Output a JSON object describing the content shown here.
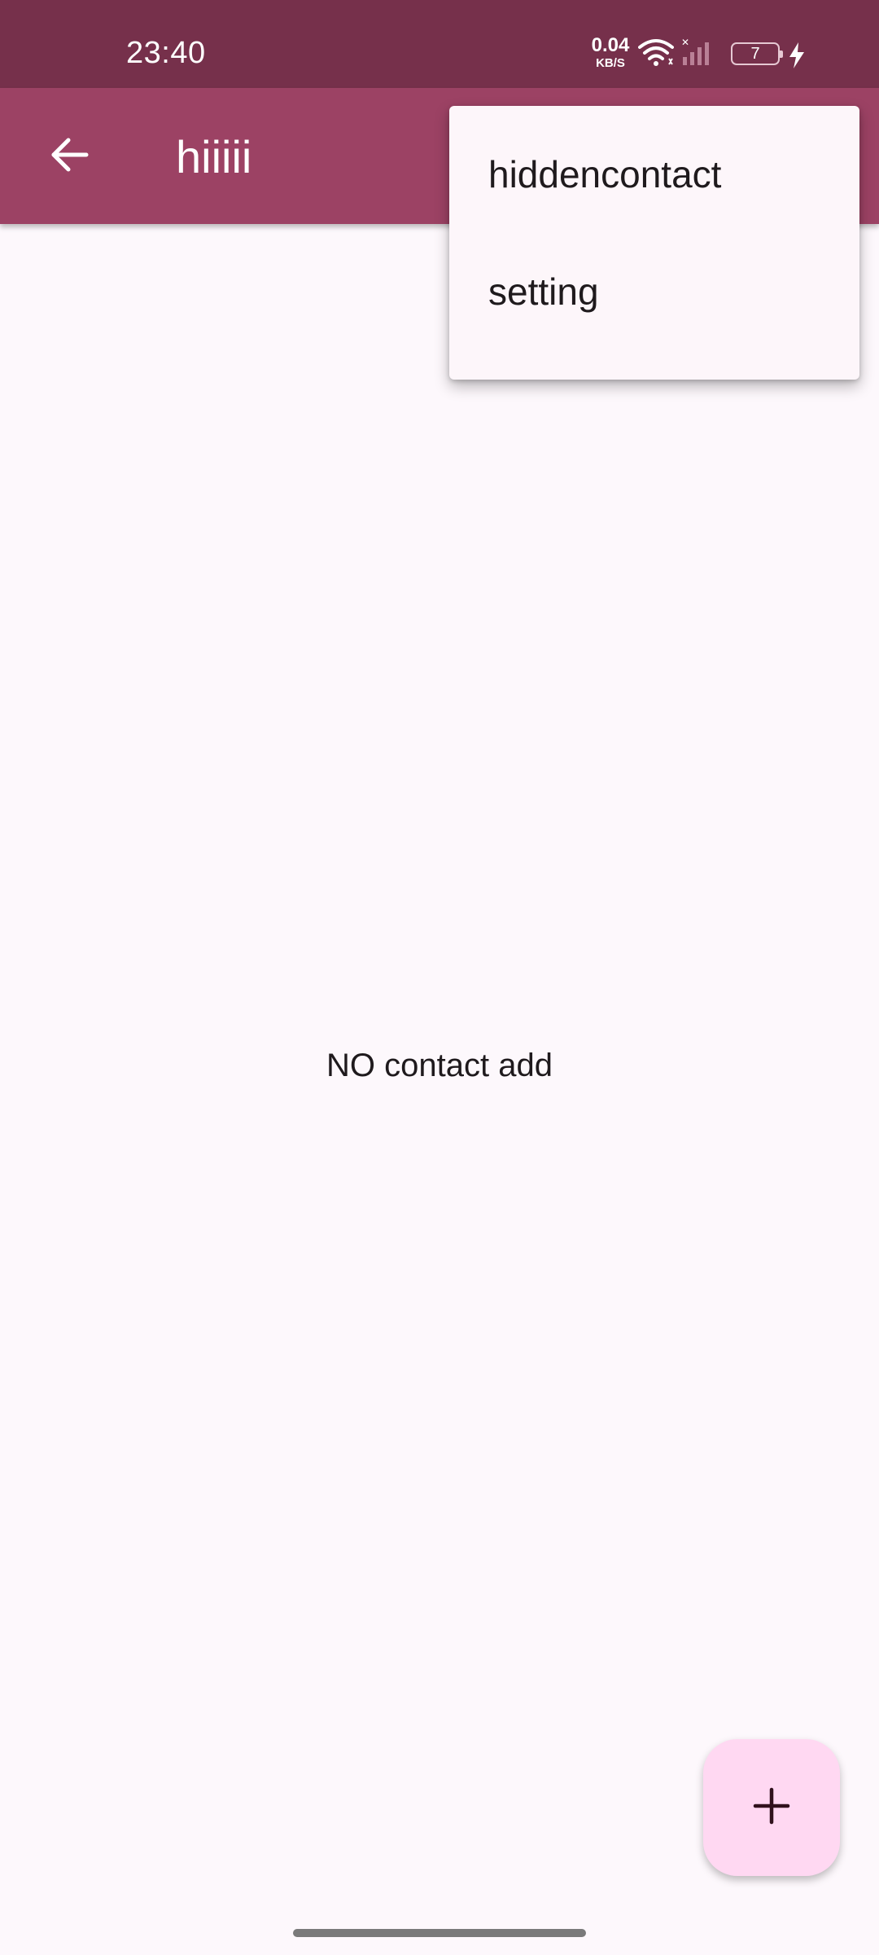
{
  "status_bar": {
    "time": "23:40",
    "net_speed_value": "0.04",
    "net_speed_unit": "KB/S",
    "battery_level": "7",
    "icons": [
      "wifi-icon",
      "signal-icon",
      "battery-icon",
      "charging-icon"
    ]
  },
  "app_bar": {
    "title": "hiiiii",
    "back_icon": "arrow-back-icon"
  },
  "menu": {
    "items": [
      {
        "label": "hiddencontact"
      },
      {
        "label": "setting"
      }
    ]
  },
  "main": {
    "empty_message": "NO contact add"
  },
  "fab": {
    "icon": "plus-icon"
  },
  "colors": {
    "status_bar": "#76304b",
    "app_bar": "#9c4264",
    "background": "#fdf8fc",
    "menu_background": "#fdf6fa",
    "fab_background": "#ffd8f2",
    "fab_icon": "#31111d"
  }
}
